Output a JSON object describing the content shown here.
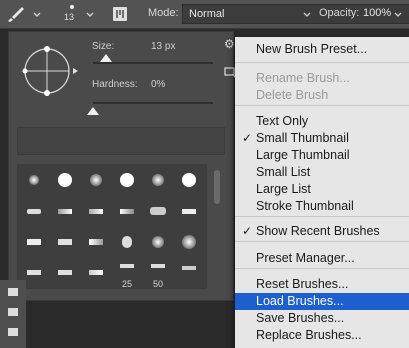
{
  "toolbar": {
    "size_value": "13",
    "mode_label": "Mode:",
    "mode_value": "Normal",
    "opacity_label": "Opacity:",
    "opacity_value": "100%"
  },
  "panel": {
    "size_label": "Size:",
    "size_value": "13 px",
    "hardness_label": "Hardness:",
    "hardness_value": "0%",
    "size_fraction": 0.06,
    "hardness_fraction": 0.0,
    "brush_numbers": [
      "25",
      "50"
    ]
  },
  "menu": {
    "items": [
      {
        "label": "New Brush Preset...",
        "state": "normal"
      },
      {
        "label": "Rename Brush...",
        "state": "disabled"
      },
      {
        "label": "Delete Brush",
        "state": "disabled"
      },
      {
        "label": "Text Only",
        "state": "normal"
      },
      {
        "label": "Small Thumbnail",
        "state": "checked"
      },
      {
        "label": "Large Thumbnail",
        "state": "normal"
      },
      {
        "label": "Small List",
        "state": "normal"
      },
      {
        "label": "Large List",
        "state": "normal"
      },
      {
        "label": "Stroke Thumbnail",
        "state": "normal"
      },
      {
        "label": "Show Recent Brushes",
        "state": "checked"
      },
      {
        "label": "Preset Manager...",
        "state": "normal"
      },
      {
        "label": "Reset Brushes...",
        "state": "normal"
      },
      {
        "label": "Load Brushes...",
        "state": "selected"
      },
      {
        "label": "Save Brushes...",
        "state": "normal"
      },
      {
        "label": "Replace Brushes...",
        "state": "normal"
      }
    ],
    "check_mark": "✓"
  },
  "colors": {
    "menu_highlight": "#1d5fce",
    "toolbar_bg": "#535353",
    "panel_bg": "#4a4a4a"
  }
}
